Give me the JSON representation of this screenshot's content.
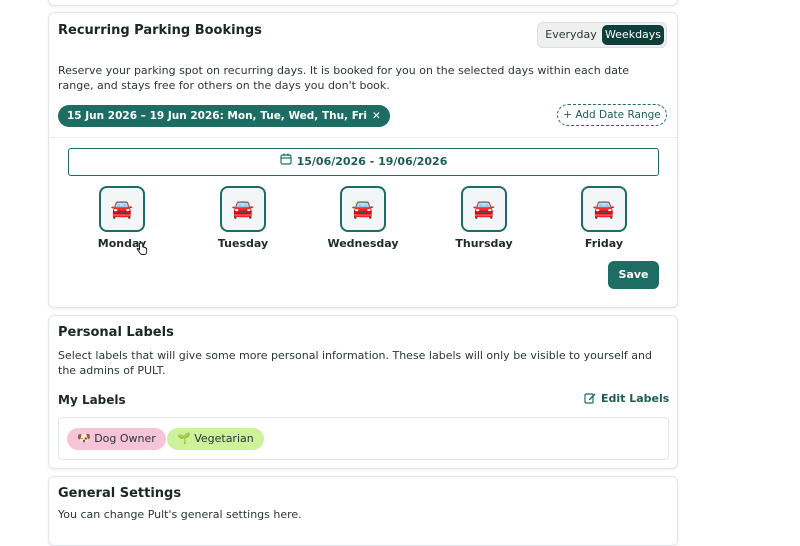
{
  "recurring": {
    "title": "Recurring Parking Bookings",
    "toggle": {
      "everyday": "Everyday",
      "weekdays": "Weekdays",
      "selected": "Weekdays"
    },
    "description": "Reserve your parking spot on recurring days. It is booked for you on the selected days within each date range, and stays free for others on the days you don't book.",
    "chip_label": "15 Jun 2026 – 19 Jun 2026: Mon, Tue, Wed, Thu, Fri",
    "chip_remove": "✕",
    "add_date_range": "+ Add Date Range",
    "date_range": "15/06/2026 - 19/06/2026",
    "days": [
      "Monday",
      "Tuesday",
      "Wednesday",
      "Thursday",
      "Friday"
    ],
    "day_icon": "🚘",
    "save_label": "Save"
  },
  "personal": {
    "title": "Personal Labels",
    "description": "Select labels that will give some more personal information. These labels will only be visible to yourself and the admins of PULT.",
    "my_labels_title": "My Labels",
    "edit_labels": "Edit Labels",
    "labels": [
      "🐶 Dog Owner",
      "🌱 Vegetarian"
    ]
  },
  "general": {
    "title": "General Settings",
    "description": "You can change Pult's general settings here."
  },
  "colors": {
    "accent": "#1e6d64",
    "toggle_selected": "#0f3d3a",
    "dog_label": "#f6c4d8",
    "veg_label": "#cdf29a"
  },
  "icons": [
    "calendar-icon",
    "car-icon",
    "close-icon",
    "edit-icon",
    "hand-cursor-icon"
  ]
}
